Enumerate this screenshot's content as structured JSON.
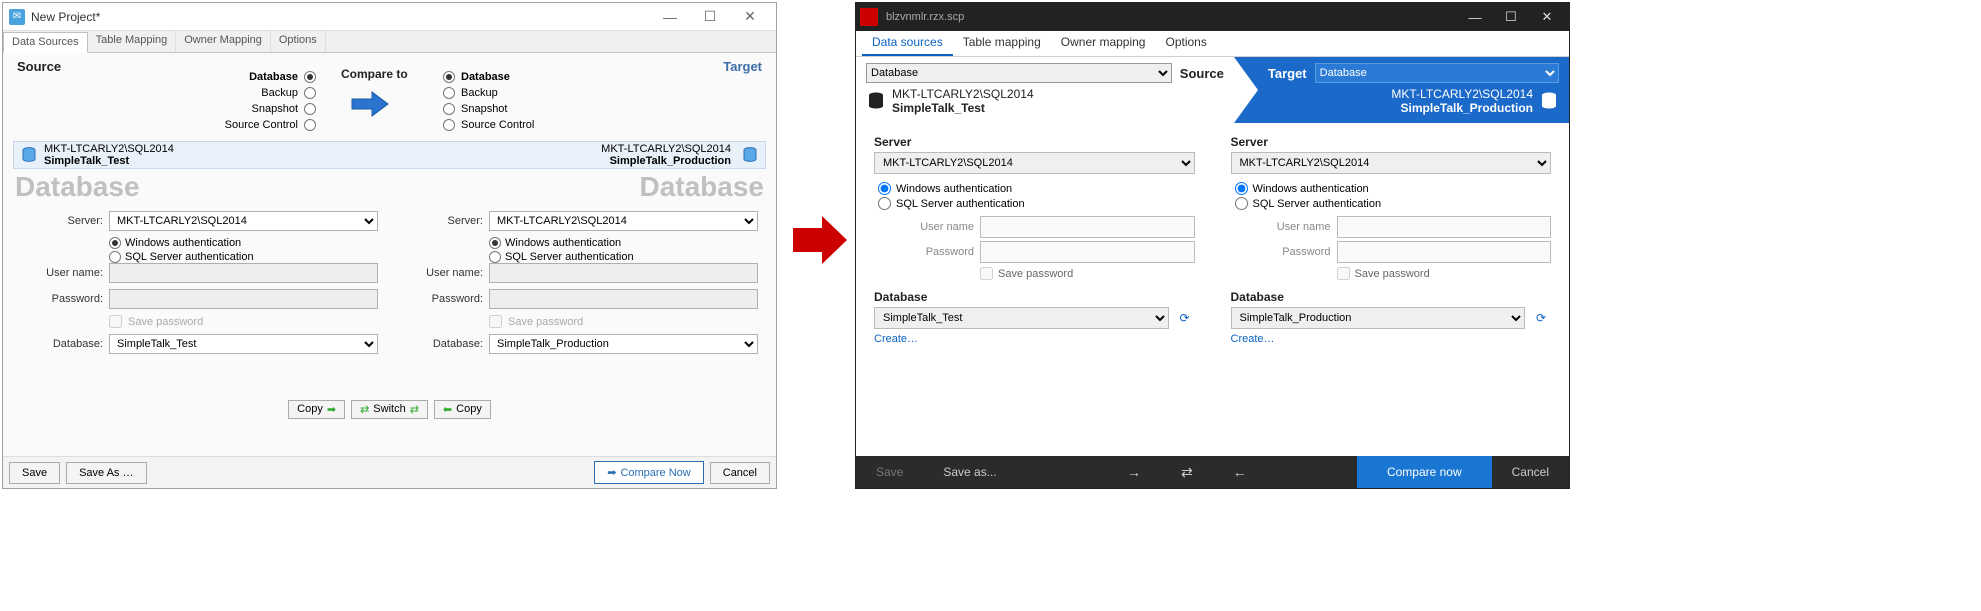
{
  "old": {
    "title": "New Project*",
    "tabs": [
      "Data Sources",
      "Table Mapping",
      "Owner Mapping",
      "Options"
    ],
    "source_label": "Source",
    "target_label": "Target",
    "compare_to": "Compare to",
    "types": [
      "Database",
      "Backup",
      "Snapshot",
      "Source Control"
    ],
    "source": {
      "server_summary": "MKT-LTCARLY2\\SQL2014",
      "db_summary": "SimpleTalk_Test",
      "big_label": "Database",
      "server_label": "Server:",
      "server_value": "MKT-LTCARLY2\\SQL2014",
      "auth_win": "Windows authentication",
      "auth_sql": "SQL Server authentication",
      "username_label": "User name:",
      "password_label": "Password:",
      "savepass": "Save password",
      "db_label": "Database:",
      "db_value": "SimpleTalk_Test"
    },
    "target": {
      "server_summary": "MKT-LTCARLY2\\SQL2014",
      "db_summary": "SimpleTalk_Production",
      "big_label": "Database",
      "server_label": "Server:",
      "server_value": "MKT-LTCARLY2\\SQL2014",
      "auth_win": "Windows authentication",
      "auth_sql": "SQL Server authentication",
      "username_label": "User name:",
      "password_label": "Password:",
      "savepass": "Save password",
      "db_label": "Database:",
      "db_value": "SimpleTalk_Production"
    },
    "mid": {
      "copy_right": "Copy",
      "switch": "Switch",
      "copy_left": "Copy"
    },
    "footer": {
      "save": "Save",
      "saveas": "Save As …",
      "compare": "Compare Now",
      "cancel": "Cancel"
    }
  },
  "new": {
    "title": "blzvnmlr.rzx.scp",
    "tabs": [
      "Data sources",
      "Table mapping",
      "Owner mapping",
      "Options"
    ],
    "header": {
      "source_label": "Source",
      "target_label": "Target",
      "source_type": "Database",
      "target_type": "Database",
      "src_server": "MKT-LTCARLY2\\SQL2014",
      "src_db": "SimpleTalk_Test",
      "tgt_server": "MKT-LTCARLY2\\SQL2014",
      "tgt_db": "SimpleTalk_Production"
    },
    "panel": {
      "server_label": "Server",
      "auth_win": "Windows authentication",
      "auth_sql": "SQL Server authentication",
      "username_label": "User name",
      "password_label": "Password",
      "savepass": "Save password",
      "db_label": "Database",
      "create": "Create…"
    },
    "source": {
      "server": "MKT-LTCARLY2\\SQL2014",
      "db": "SimpleTalk_Test"
    },
    "target": {
      "server": "MKT-LTCARLY2\\SQL2014",
      "db": "SimpleTalk_Production"
    },
    "footer": {
      "save": "Save",
      "saveas": "Save as...",
      "compare": "Compare now",
      "cancel": "Cancel"
    }
  }
}
